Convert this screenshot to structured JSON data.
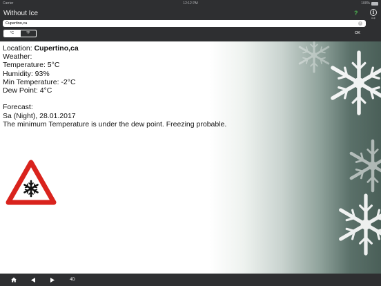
{
  "status_bar": {
    "carrier": "Carrier",
    "time": "12:12 PM",
    "battery": "100%"
  },
  "header": {
    "title": "Without Ice",
    "help_label": "?",
    "info_label": "Help"
  },
  "search": {
    "value": "Cupertino,ca",
    "placeholder": ""
  },
  "unit_toggle": {
    "celsius_label": "°C",
    "fahrenheit_label": "°F",
    "selected": "°C"
  },
  "ok_label": "OK",
  "weather": {
    "location_label": "Location: ",
    "location_value": "Cupertino,ca",
    "weather_label": "Weather:",
    "temperature": "Temperature: 5°C",
    "humidity": "Humidity: 93%",
    "min_temperature": "Min Temperature: -2°C",
    "dew_point": "Dew Point: 4°C"
  },
  "forecast": {
    "label": "Forecast:",
    "date": "Sa (Night), 28.01.2017",
    "message": "The minimum Temperature is under the dew point. Freezing probable."
  },
  "colors": {
    "bar_background": "#2e2f31",
    "warning_red": "#d9231d",
    "help_green": "#4caf50"
  },
  "icons": {
    "warning": "snowflake-warning-sign-icon",
    "home": "home-icon",
    "back": "triangle-left-icon",
    "forward": "triangle-right-icon"
  },
  "toolbar": {
    "fourd_label": "4D"
  }
}
